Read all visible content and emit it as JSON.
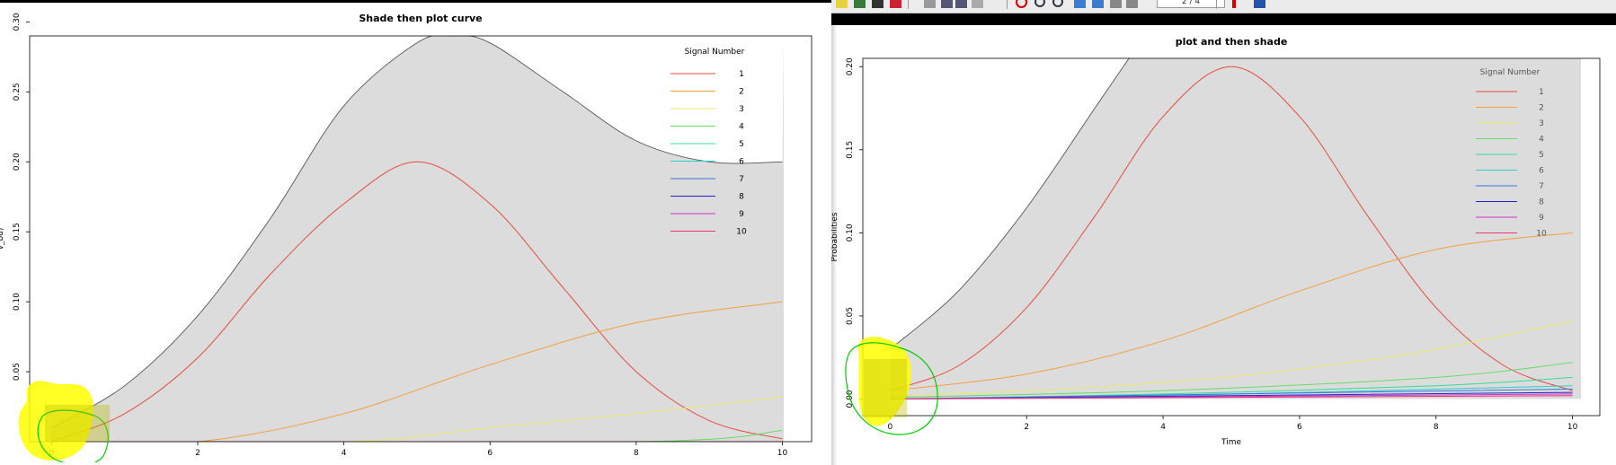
{
  "toolbar": {
    "page_value": "2 / 4",
    "accent_color": "#d40000",
    "buttons": [
      {
        "name": "folder-icon"
      },
      {
        "name": "grid-icon"
      },
      {
        "name": "print-icon"
      },
      {
        "name": "cut-icon"
      },
      {
        "name": "scissors-icon"
      },
      {
        "name": "copy-icon"
      },
      {
        "name": "paste-icon"
      },
      {
        "name": "undo-icon"
      },
      {
        "name": "stop-icon"
      },
      {
        "name": "zoom-in-icon"
      },
      {
        "name": "zoom-out-icon"
      },
      {
        "name": "back-icon"
      },
      {
        "name": "forward-icon"
      },
      {
        "name": "first-page-icon"
      },
      {
        "name": "last-page-icon"
      },
      {
        "name": "pin-icon"
      },
      {
        "name": "screen-icon"
      }
    ]
  },
  "annotations": {
    "highlight_color": "#ffff00",
    "circle_color": "#00cc00"
  },
  "chart_data": [
    {
      "type": "line",
      "title": "Shade then plot curve",
      "xlabel": "",
      "ylabel": "v_bu)",
      "xlim": [
        -0.3,
        10.4
      ],
      "ylim": [
        0,
        0.29
      ],
      "x_ticks": [
        "0",
        "2",
        "4",
        "6",
        "8",
        "10"
      ],
      "y_ticks": [
        "0.05",
        "0.10",
        "0.15",
        "0.20",
        "0.25",
        "0.30"
      ],
      "shaded_region": {
        "color": "#dcdcdc",
        "x": [
          0,
          1,
          2,
          3,
          4,
          5,
          5.5,
          6,
          7,
          8,
          9,
          10
        ],
        "upper": [
          0.01,
          0.04,
          0.09,
          0.16,
          0.24,
          0.285,
          0.29,
          0.285,
          0.25,
          0.215,
          0.2,
          0.2
        ]
      },
      "legend": {
        "title": "Signal Number",
        "position": "top-right"
      },
      "series": [
        {
          "name": "1",
          "color": "#e74c3c",
          "x": [
            0,
            1,
            2,
            3,
            4,
            5,
            6,
            7,
            8,
            9,
            10
          ],
          "values": [
            0.0,
            0.02,
            0.06,
            0.12,
            0.17,
            0.2,
            0.17,
            0.11,
            0.05,
            0.015,
            0.002
          ]
        },
        {
          "name": "2",
          "color": "#f0a040",
          "x": [
            0,
            2,
            4,
            6,
            8,
            10
          ],
          "values": [
            0.0,
            0.0,
            0.02,
            0.055,
            0.085,
            0.1
          ]
        },
        {
          "name": "3",
          "color": "#e8e870",
          "x": [
            0,
            4,
            6,
            8,
            10
          ],
          "values": [
            0.0,
            0.0,
            0.01,
            0.02,
            0.032
          ]
        },
        {
          "name": "4",
          "color": "#66dd66",
          "x": [
            0,
            8,
            10
          ],
          "values": [
            0.0,
            0.0,
            0.008
          ]
        },
        {
          "name": "5",
          "color": "#33dd99",
          "x": [
            0,
            10
          ],
          "values": [
            0.0,
            0.0
          ]
        },
        {
          "name": "6",
          "color": "#33cccc",
          "x": [
            0,
            10
          ],
          "values": [
            0.0,
            0.0
          ]
        },
        {
          "name": "7",
          "color": "#3377dd",
          "x": [
            0,
            10
          ],
          "values": [
            0.0,
            0.0
          ]
        },
        {
          "name": "8",
          "color": "#2222cc",
          "x": [
            0,
            10
          ],
          "values": [
            0.0,
            0.0
          ]
        },
        {
          "name": "9",
          "color": "#cc33cc",
          "x": [
            0,
            10
          ],
          "values": [
            0.0,
            0.0
          ]
        },
        {
          "name": "10",
          "color": "#ee3377",
          "x": [
            0,
            10
          ],
          "values": [
            0.0,
            0.0
          ]
        }
      ]
    },
    {
      "type": "line",
      "title": "plot and then shade",
      "xlabel": "Time",
      "ylabel": "Probabilities",
      "xlim": [
        -0.4,
        10.4
      ],
      "ylim": [
        -0.01,
        0.205
      ],
      "x_ticks": [
        "0",
        "2",
        "4",
        "6",
        "8",
        "10"
      ],
      "y_ticks": [
        "0.00",
        "0.05",
        "0.10",
        "0.15",
        "0.20"
      ],
      "shaded_region": {
        "color": "#dcdcdc",
        "x": [
          0,
          1,
          2,
          3,
          3.5
        ],
        "upper": [
          0.03,
          0.065,
          0.115,
          0.175,
          0.205
        ]
      },
      "legend": {
        "title": "Signal Number",
        "position": "top-right"
      },
      "series": [
        {
          "name": "1",
          "color": "#e74c3c",
          "x": [
            0,
            1,
            2,
            3,
            4,
            5,
            6,
            7,
            8,
            9,
            10
          ],
          "values": [
            0.005,
            0.02,
            0.055,
            0.11,
            0.17,
            0.2,
            0.17,
            0.11,
            0.055,
            0.02,
            0.005
          ]
        },
        {
          "name": "2",
          "color": "#f0a040",
          "x": [
            0,
            2,
            4,
            6,
            8,
            10
          ],
          "values": [
            0.005,
            0.015,
            0.035,
            0.065,
            0.09,
            0.1
          ]
        },
        {
          "name": "3",
          "color": "#e8e870",
          "x": [
            0,
            2,
            4,
            6,
            8,
            10
          ],
          "values": [
            0.002,
            0.005,
            0.01,
            0.018,
            0.03,
            0.047
          ]
        },
        {
          "name": "4",
          "color": "#66dd66",
          "x": [
            0,
            4,
            8,
            10
          ],
          "values": [
            0.001,
            0.005,
            0.013,
            0.022
          ]
        },
        {
          "name": "5",
          "color": "#33dd99",
          "x": [
            0,
            4,
            8,
            10
          ],
          "values": [
            0.0,
            0.003,
            0.008,
            0.013
          ]
        },
        {
          "name": "6",
          "color": "#33cccc",
          "x": [
            0,
            4,
            10
          ],
          "values": [
            0.0,
            0.002,
            0.008
          ]
        },
        {
          "name": "7",
          "color": "#3377dd",
          "x": [
            0,
            10
          ],
          "values": [
            0.0,
            0.006
          ]
        },
        {
          "name": "8",
          "color": "#2222cc",
          "x": [
            0,
            10
          ],
          "values": [
            0.0,
            0.004
          ]
        },
        {
          "name": "9",
          "color": "#cc33cc",
          "x": [
            0,
            10
          ],
          "values": [
            0.0,
            0.003
          ]
        },
        {
          "name": "10",
          "color": "#ee3377",
          "x": [
            0,
            10
          ],
          "values": [
            0.0,
            0.002
          ]
        }
      ]
    }
  ]
}
